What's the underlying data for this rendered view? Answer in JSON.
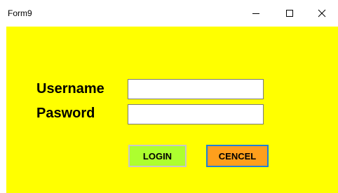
{
  "window": {
    "title": "Form9",
    "controls": {
      "minimize_icon": "minimize-icon",
      "maximize_icon": "maximize-icon",
      "close_icon": "close-icon"
    }
  },
  "form": {
    "background_color": "#ffff00",
    "username_label": "Username",
    "password_label": "Pasword",
    "username_value": "",
    "password_value": "",
    "login_label": "LOGIN",
    "cancel_label": "CENCEL",
    "login_color": "#adff2f",
    "cancel_color": "#ff9f1c"
  }
}
